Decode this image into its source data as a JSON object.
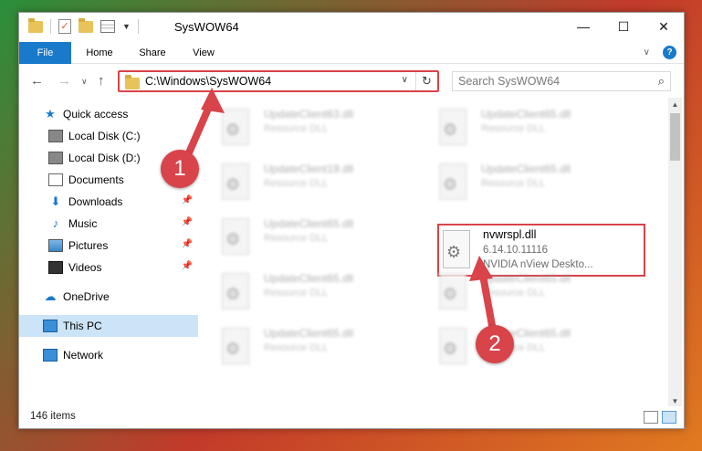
{
  "window": {
    "title": "SysWOW64",
    "controls": {
      "minimize": "—",
      "maximize": "☐",
      "close": "✕"
    }
  },
  "ribbon": {
    "tabs": [
      "File",
      "Home",
      "Share",
      "View"
    ]
  },
  "navigation": {
    "address": "C:\\Windows\\SysWOW64",
    "search_placeholder": "Search SysWOW64"
  },
  "sidebar": {
    "items": [
      {
        "label": "Quick access",
        "icon": "star-icon"
      },
      {
        "label": "Local Disk (C:)",
        "icon": "drive-icon"
      },
      {
        "label": "Local Disk (D:)",
        "icon": "drive-icon"
      },
      {
        "label": "Documents",
        "icon": "documents-icon",
        "pinned": true
      },
      {
        "label": "Downloads",
        "icon": "downloads-icon",
        "pinned": true
      },
      {
        "label": "Music",
        "icon": "music-icon",
        "pinned": true
      },
      {
        "label": "Pictures",
        "icon": "pictures-icon",
        "pinned": true
      },
      {
        "label": "Videos",
        "icon": "videos-icon",
        "pinned": true
      },
      {
        "label": "OneDrive",
        "icon": "onedrive-icon"
      },
      {
        "label": "This PC",
        "icon": "this-pc-icon",
        "selected": true
      },
      {
        "label": "Network",
        "icon": "network-icon"
      }
    ]
  },
  "files": {
    "blurred": [
      {
        "name": "UpdateClient63.dll",
        "type": "Resource DLL"
      },
      {
        "name": "UpdateClient65.dll",
        "type": "Resource DLL"
      },
      {
        "name": "UpdateClient19.dll",
        "type": "Resource DLL"
      },
      {
        "name": "UpdateClient65.dll",
        "type": "Resource DLL"
      },
      {
        "name": "UpdateClient65.dll",
        "type": "Resource DLL"
      },
      {
        "name": "UpdateClient65.dll",
        "type": "Resource DLL"
      },
      {
        "name": "UpdateClient65.dll",
        "type": "Resource DLL"
      },
      {
        "name": "UpdateClient65.dll",
        "type": "Resource DLL"
      },
      {
        "name": "UpdateClient65.dll",
        "type": "Resource DLL"
      }
    ],
    "highlighted": {
      "name": "nvwrspl.dll",
      "version": "6.14.10.11116",
      "description": "NVIDIA nView Deskto..."
    }
  },
  "status": {
    "item_count": "146 items"
  },
  "callouts": [
    "1",
    "2"
  ],
  "colors": {
    "accent": "#1979ca",
    "highlight_border": "#d9434a",
    "selected_bg": "#cce4f7"
  }
}
